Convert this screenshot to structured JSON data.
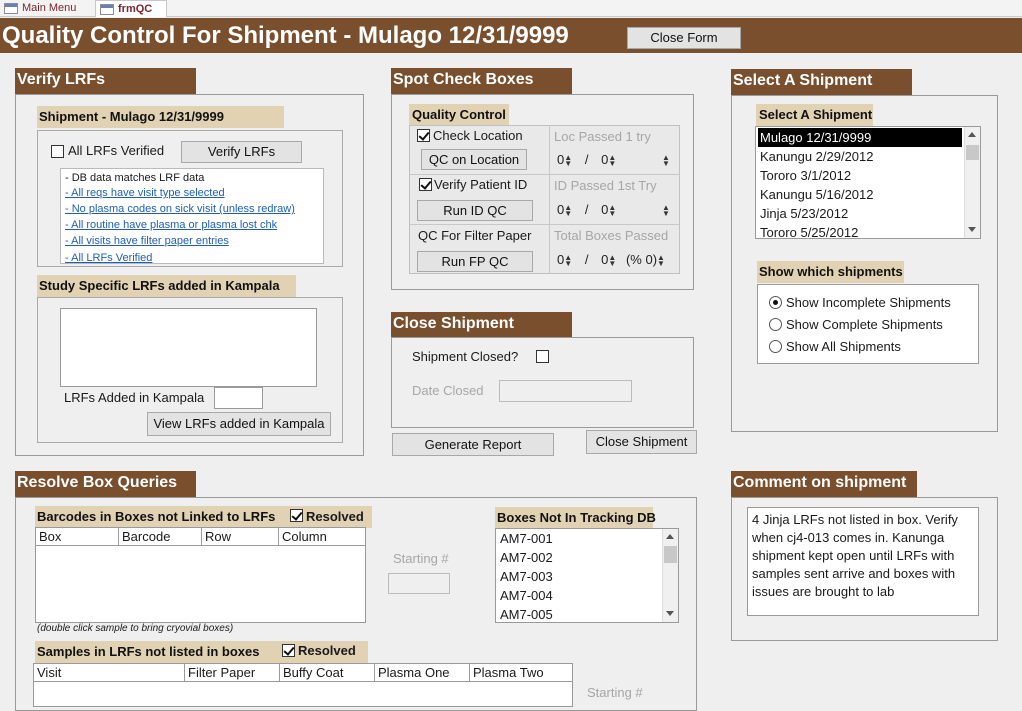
{
  "tabs": {
    "main": "Main Menu",
    "qc": "frmQC"
  },
  "title": "Quality Control For Shipment - Mulago 12/31/9999",
  "close_form": "Close Form",
  "verify": {
    "header": "Verify LRFs",
    "shipment_label": "Shipment - Mulago 12/31/9999",
    "all_verified": "All LRFs Verified",
    "verify_button": "Verify LRFs",
    "checks_title": "- DB data matches LRF data",
    "checks": [
      "- All reqs have visit type selected",
      "- No plasma codes on sick visit (unless redraw)",
      "- All routine have plasma or plasma lost chk",
      "- All visits have filter paper entries",
      "- All LRFs Verified"
    ],
    "study_specific": "Study Specific LRFs added in Kampala",
    "added_label": "LRFs Added in Kampala",
    "view_button": "View LRFs added in Kampala"
  },
  "spot": {
    "header": "Spot Check Boxes",
    "qc_label": "Quality Control",
    "check_location": "Check Location",
    "qc_location_btn": "QC on Location",
    "loc_passed": "Loc Passed 1 try",
    "verify_patient": "Verify Patient ID",
    "run_id_btn": "Run ID QC",
    "id_passed": "ID Passed 1st Try",
    "qc_filter": "QC For Filter Paper",
    "run_fp_btn": "Run FP QC",
    "total_boxes": "Total Boxes Passed",
    "spin_a": "0",
    "spin_b": "0",
    "slash": "/",
    "pct": "(% 0)"
  },
  "close_ship": {
    "header": "Close Shipment",
    "closed_label": "Shipment Closed?",
    "date_closed": "Date Closed",
    "generate_btn": "Generate Report",
    "close_btn": "Close Shipment"
  },
  "select": {
    "header": "Select A Shipment",
    "sub": "Select A Shipment",
    "items": [
      "Mulago 12/31/9999",
      "Kanungu 2/29/2012",
      "Tororo 3/1/2012",
      "Kanungu 5/16/2012",
      "Jinja 5/23/2012",
      "Tororo 5/25/2012"
    ],
    "which_label": "Show which shipments",
    "options": [
      "Show Incomplete Shipments",
      "Show Complete Shipments",
      "Show All Shipments"
    ]
  },
  "resolve": {
    "header": "Resolve Box Queries",
    "barcodes_label": "Barcodes in Boxes not Linked to LRFs",
    "resolved": "Resolved",
    "cols1": [
      "Box",
      "Barcode",
      "Row",
      "Column"
    ],
    "starting": "Starting #",
    "note": "(double click sample to bring cryovial boxes)",
    "samples_label": "Samples in LRFs not listed in boxes",
    "cols2": [
      "Visit",
      "Filter Paper",
      "Buffy Coat",
      "Plasma One",
      "Plasma Two"
    ],
    "boxes_label": "Boxes Not In Tracking DB",
    "boxes": [
      "AM7-001",
      "AM7-002",
      "AM7-003",
      "AM7-004",
      "AM7-005"
    ]
  },
  "comment": {
    "header": "Comment on shipment",
    "lines": [
      "4 Jinja LRFs not listed in box.  Verify",
      "when cj4-013 comes in. Kanunga",
      "shipment kept open until LRFs with",
      "samples sent arrive and boxes with",
      "issues are brought to lab"
    ]
  }
}
